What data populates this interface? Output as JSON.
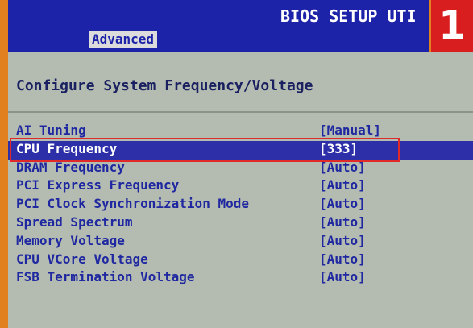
{
  "header": {
    "title": "BIOS SETUP UTI",
    "active_tab": "Advanced",
    "badge": "1"
  },
  "main": {
    "section_title": "Configure System Frequency/Voltage",
    "settings": [
      {
        "label": "AI Tuning",
        "value": "[Manual]"
      },
      {
        "label": "CPU Frequency",
        "value": "[333]",
        "selected": true
      },
      {
        "label": "DRAM Frequency",
        "value": "[Auto]"
      },
      {
        "label": "PCI Express Frequency",
        "value": "[Auto]"
      },
      {
        "label": "PCI Clock Synchronization Mode",
        "value": "[Auto]"
      },
      {
        "label": "Spread Spectrum",
        "value": "[Auto]"
      },
      {
        "label": "Memory Voltage",
        "value": "[Auto]"
      },
      {
        "label": "CPU VCore Voltage",
        "value": "[Auto]"
      },
      {
        "label": "FSB Termination Voltage",
        "value": "[Auto]"
      }
    ]
  },
  "colors": {
    "header_bg": "#1c23a8",
    "panel_bg": "#b4bcb1",
    "text": "#1f28a0",
    "selected_bg": "#2c2fa8",
    "highlight_border": "#e02a2a",
    "badge_bg": "#d81e1e",
    "outer_border": "#e0801e"
  }
}
